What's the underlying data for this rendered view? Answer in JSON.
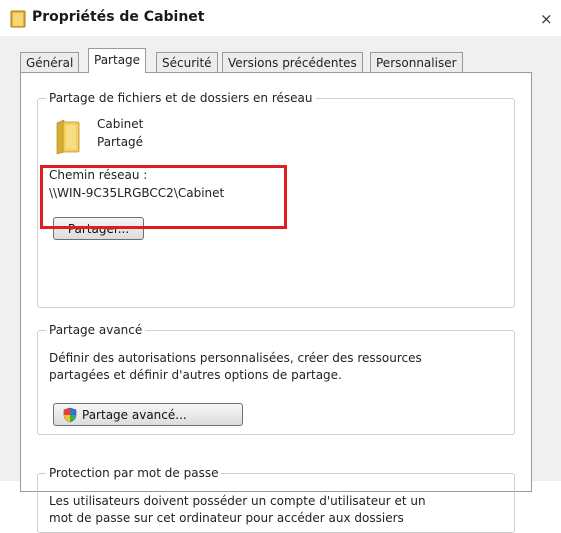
{
  "window": {
    "title": "Propriétés de Cabinet",
    "close_symbol": "×"
  },
  "tabs": [
    {
      "label": "Général",
      "active": false
    },
    {
      "label": "Partage",
      "active": true
    },
    {
      "label": "Sécurité",
      "active": false
    },
    {
      "label": "Versions précédentes",
      "active": false
    },
    {
      "label": "Personnaliser",
      "active": false
    }
  ],
  "network_sharing": {
    "legend": "Partage de fichiers et de dossiers en réseau",
    "folder_name": "Cabinet",
    "folder_status": "Partagé",
    "network_path_label": "Chemin réseau :",
    "network_path": "\\\\WIN-9C35LRGBCC2\\Cabinet",
    "share_button": "Partager..."
  },
  "advanced_sharing": {
    "legend": "Partage avancé",
    "description_line1": "Définir des autorisations personnalisées, créer des ressources",
    "description_line2": "partagées et définir d'autres options de partage.",
    "button": "Partage avancé..."
  },
  "password_protection": {
    "legend": "Protection par mot de passe",
    "description_line1": "Les utilisateurs doivent posséder un compte d'utilisateur et un",
    "description_line2": "mot de passe sur cet ordinateur pour accéder aux dossiers"
  },
  "colors": {
    "highlight_border": "#e01e1e",
    "folder_yellow": "#f2cf5b",
    "panel_background": "#ffffff",
    "dialog_background": "#f0f0f0"
  },
  "icons": {
    "title": "folder-icon",
    "folder": "folder-icon",
    "shield": "uac-shield-icon"
  }
}
